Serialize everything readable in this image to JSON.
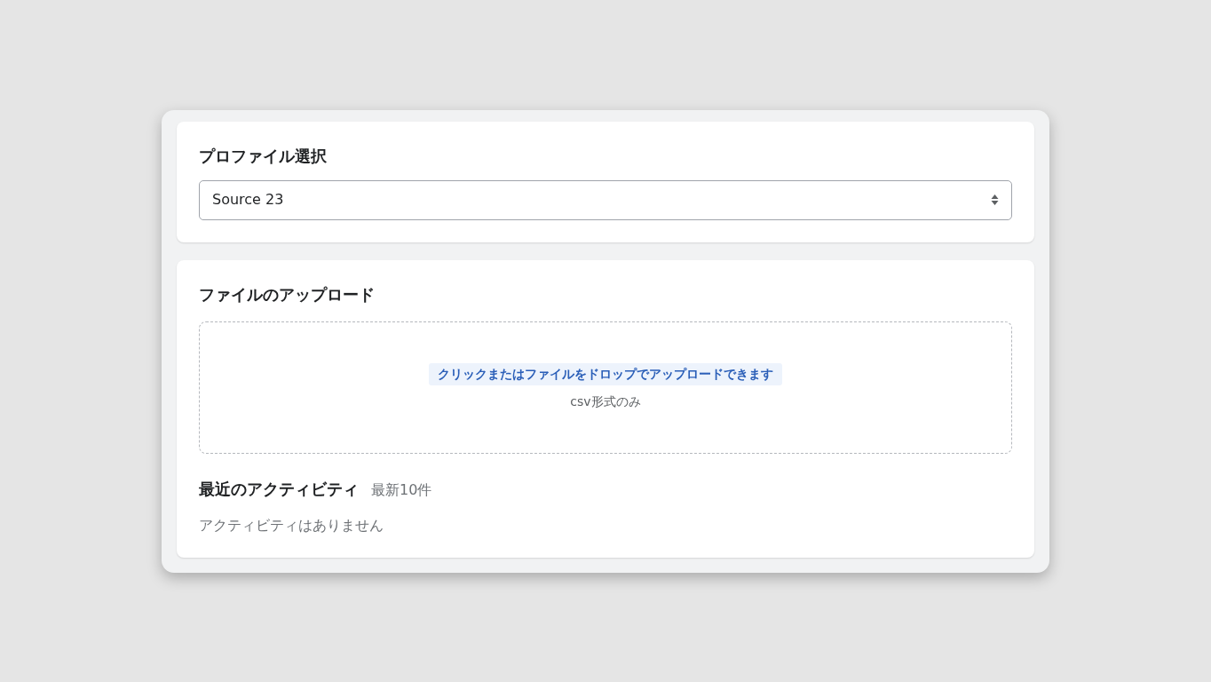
{
  "profile": {
    "title": "プロファイル選択",
    "select": {
      "value": "Source 23"
    }
  },
  "upload": {
    "title": "ファイルのアップロード",
    "dropzone": {
      "link": "クリックまたはファイルをドロップでアップロードできます",
      "hint": "csv形式のみ"
    }
  },
  "activity": {
    "title": "最近のアクティビティ",
    "count": "最新10件",
    "empty": "アクティビティはありません"
  }
}
